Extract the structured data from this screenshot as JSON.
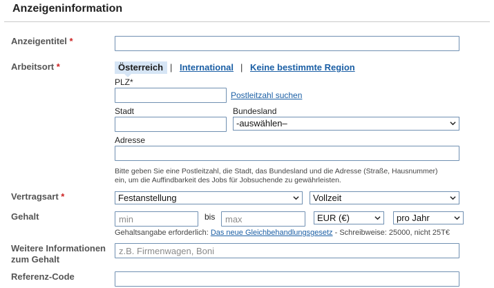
{
  "section_title": "Anzeigeninformation",
  "required_mark": "*",
  "fields": {
    "title_label": "Anzeigentitel",
    "location_label": "Arbeitsort",
    "contract_label": "Vertragsart",
    "salary_label": "Gehalt",
    "salary_info_label_line1": "Weitere Informationen",
    "salary_info_label_line2": "zum Gehalt",
    "ref_label": "Referenz-Code"
  },
  "location": {
    "tabs": [
      "Österreich",
      "International",
      "Keine bestimmte Region"
    ],
    "tab_separator": "|",
    "plz_label": "PLZ*",
    "plz_link": "Postleitzahl suchen",
    "city_label": "Stadt",
    "state_label": "Bundesland",
    "state_value": "-auswählen–",
    "address_label": "Adresse",
    "hint_line1": "Bitte geben Sie eine Postleitzahl, die Stadt, das Bundesland und die Adresse (Straße, Hausnummer)",
    "hint_line2": "ein, um die Auffindbarkeit des Jobs für Jobsuchende zu gewährleisten."
  },
  "contract": {
    "type_value": "Festanstellung",
    "time_value": "Vollzeit"
  },
  "salary": {
    "min_placeholder": "min",
    "bis": "bis",
    "max_placeholder": "max",
    "currency_value": "EUR (€)",
    "period_value": "pro Jahr",
    "hint_prefix": "Gehaltsangabe erforderlich: ",
    "hint_link": "Das neue Gleichbehandlungsgesetz",
    "hint_suffix": " - Schreibweise: 25000, nicht 25T€"
  },
  "salary_info": {
    "placeholder": "z.B. Firmenwagen, Boni"
  }
}
